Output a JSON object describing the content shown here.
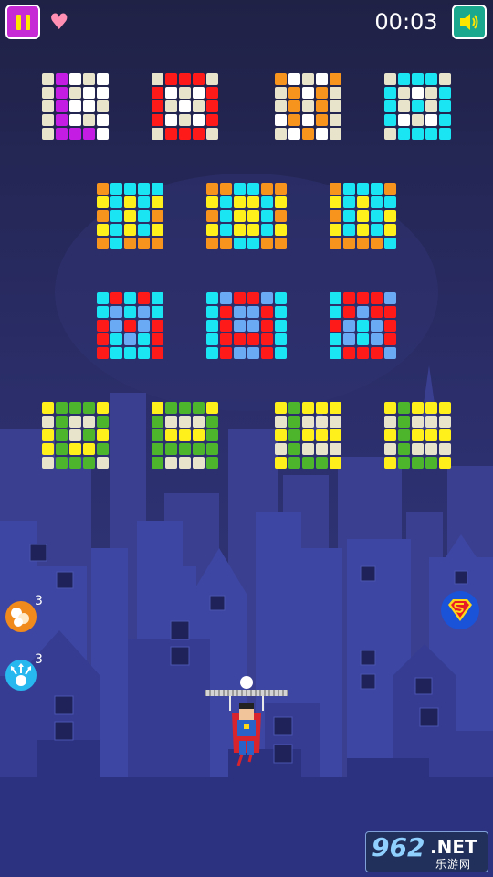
{
  "hud": {
    "timer": "00:03",
    "lives": 1,
    "pause_icon": "pause-icon",
    "sound_icon": "speaker-on-icon"
  },
  "powerups": [
    {
      "name": "multi-ball-powerup",
      "count": "3",
      "color": "#f08a1c"
    },
    {
      "name": "split-ball-powerup",
      "count": "3",
      "color": "#28b8f0"
    }
  ],
  "palette": {
    "W": "#ffffff",
    "B": "#e8e4cc",
    "M": "#c51ce3",
    "R": "#ff1a1a",
    "O": "#f7941d",
    "C": "#19e6f2",
    "Y": "#ffef1a",
    "L": "#6aaaf5",
    "G": "#4db52b"
  },
  "brick_clusters": [
    {
      "cols": 5,
      "rows": [
        "BMWBW",
        "BMBWW",
        "BMWWB",
        "BMWBW",
        "BMMMW"
      ]
    },
    {
      "cols": 5,
      "rows": [
        "BRRRB",
        "RWBWR",
        "RBWBR",
        "RWBWR",
        "BRRRB"
      ]
    },
    {
      "cols": 5,
      "rows": [
        "OWBWO",
        "BOWOB",
        "BOBOB",
        "WOWOB",
        "BWOWB"
      ]
    },
    {
      "cols": 5,
      "rows": [
        "BCCCB",
        "CBWBC",
        "CBCBC",
        "CWBWC",
        "BCCCC"
      ]
    },
    {
      "cols": 5,
      "rows": [
        "OCCCC",
        "YCYCY",
        "OCYCO",
        "YCYCY",
        "OCOOO"
      ]
    },
    {
      "cols": 6,
      "rows": [
        "OOCCOO",
        "YCYYCY",
        "OCYYCO",
        "YCYYCY",
        "OOCCOO"
      ]
    },
    {
      "cols": 5,
      "rows": [
        "OCCCO",
        "YCYCC",
        "OCYCY",
        "YCYCY",
        "OOOOC"
      ]
    },
    {
      "cols": 5,
      "rows": [
        "CRCRC",
        "CLCLC",
        "RLRLR",
        "RCLCR",
        "RCCCR"
      ]
    },
    {
      "cols": 6,
      "rows": [
        "CLRRLC",
        "CRLLRC",
        "CRLLRC",
        "CRRRRC",
        "CRLLRC"
      ]
    },
    {
      "cols": 5,
      "rows": [
        "CRRRL",
        "CRLRR",
        "RLCLR",
        "CLCLR",
        "CRRRL"
      ]
    },
    {
      "cols": 5,
      "rows": [
        "YGGGY",
        "BGBBG",
        "YGBGY",
        "YGYYG",
        "BGGGB"
      ]
    },
    {
      "cols": 5,
      "rows": [
        "YGGGY",
        "GBBBG",
        "GYYYG",
        "GGGGG",
        "GBBBG"
      ]
    },
    {
      "cols": 5,
      "rows": [
        "YGYYY",
        "BGBBB",
        "YGYYY",
        "BGBBB",
        "YGGGY"
      ]
    },
    {
      "cols": 5,
      "rows": [
        "YGYYY",
        "BGBBB",
        "YGYYY",
        "BGBBB",
        "YGGGY"
      ]
    }
  ],
  "watermark": {
    "number": "962",
    "suffix": ".NET",
    "subtitle": "乐游网"
  }
}
